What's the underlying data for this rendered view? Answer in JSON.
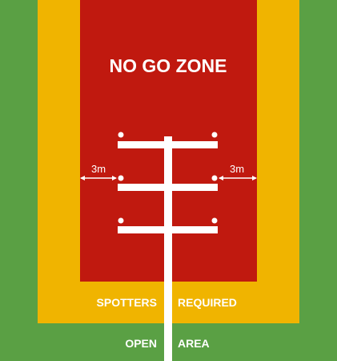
{
  "zones": {
    "no_go": {
      "label": "NO GO ZONE",
      "color": "#c0190f"
    },
    "spotters": {
      "label_left": "SPOTTERS",
      "label_right": "REQUIRED",
      "color": "#f0b400"
    },
    "open": {
      "label_left": "OPEN",
      "label_right": "AREA",
      "color": "#5aa044"
    }
  },
  "clearance": {
    "left_label": "3m",
    "right_label": "3m"
  },
  "pole": {
    "color": "#ffffff"
  }
}
